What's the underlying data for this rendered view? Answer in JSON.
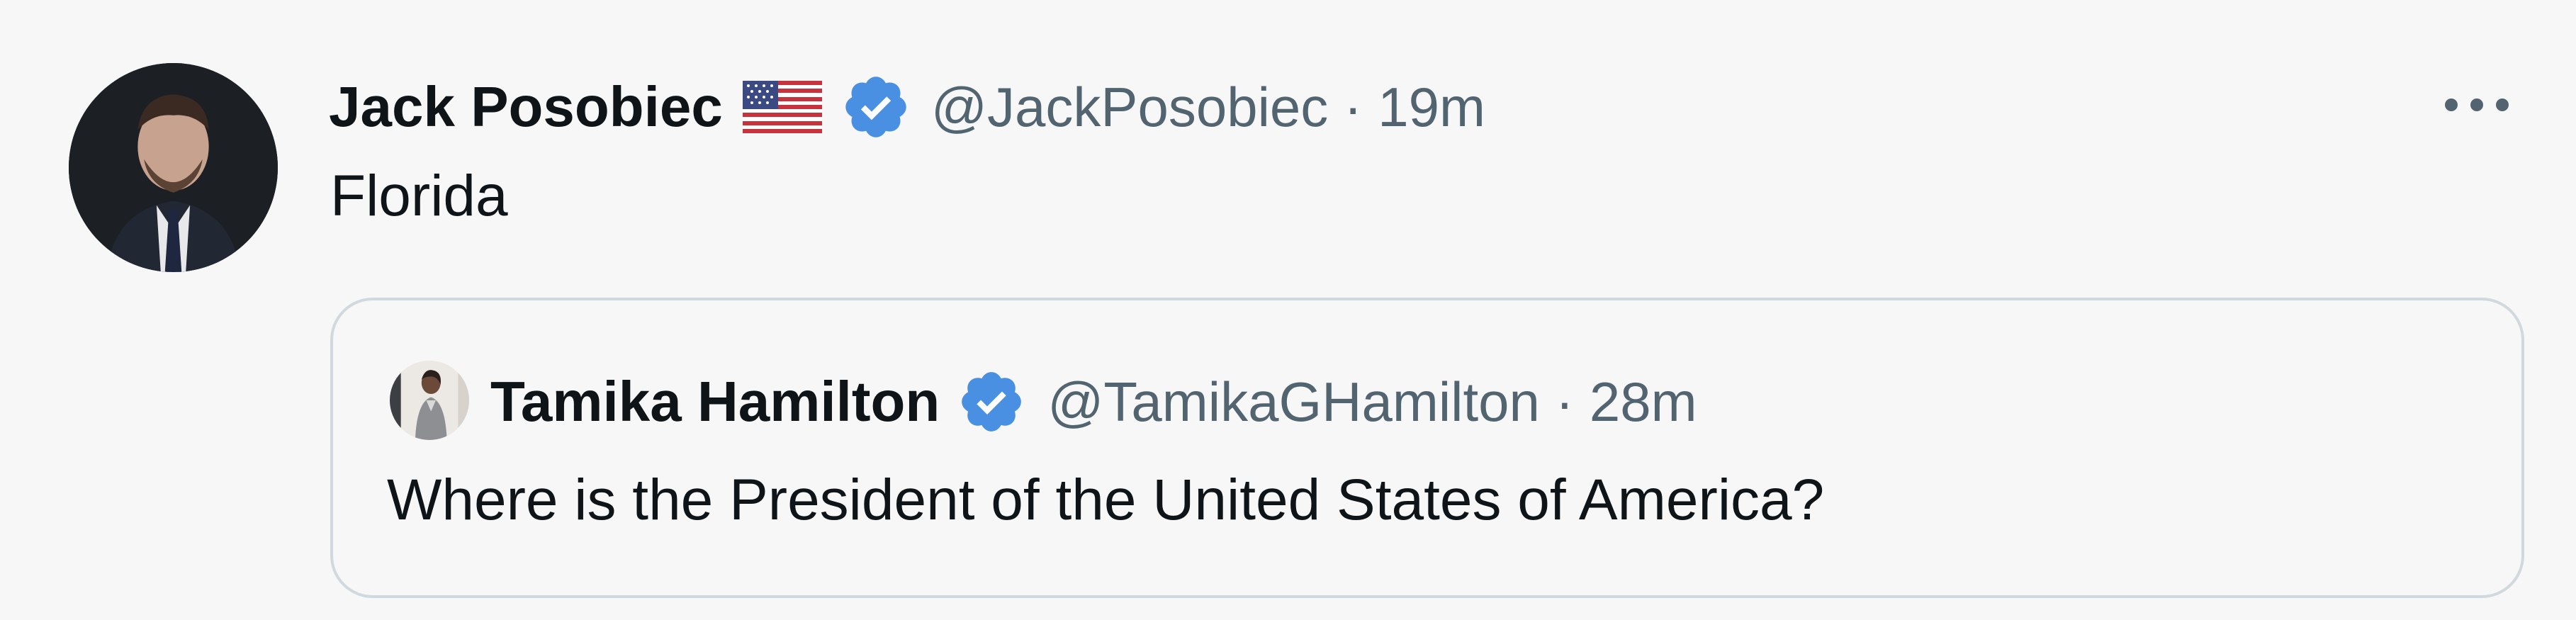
{
  "tweet": {
    "author_name": "Jack Posobiec",
    "flag_icon": "us-flag-icon",
    "verified_icon": "verified-badge-icon",
    "handle": "@JackPosobiec",
    "separator": "·",
    "time": "19m",
    "text": "Florida",
    "more_icon": "more-options-icon"
  },
  "quoted_tweet": {
    "author_name": "Tamika Hamilton",
    "verified_icon": "verified-badge-icon",
    "handle": "@TamikaGHamilton",
    "separator": "·",
    "time": "28m",
    "text": "Where is the President of the United States of America?"
  },
  "colors": {
    "background": "#f7f7f7",
    "primary_text": "#0f1419",
    "secondary_text": "#536471",
    "verified_blue": "#1d9bf0",
    "quote_border": "#cfd9de"
  }
}
